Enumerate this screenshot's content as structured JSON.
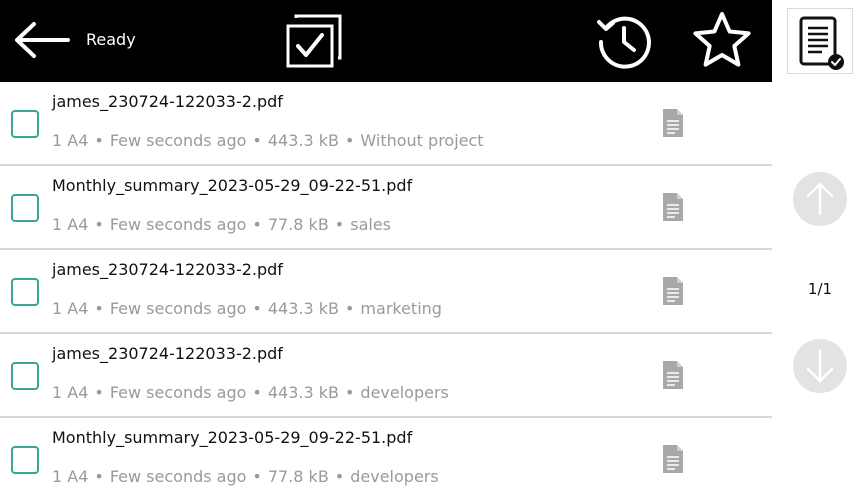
{
  "header": {
    "status": "Ready"
  },
  "pagination": {
    "indicator": "1/1"
  },
  "files": [
    {
      "name": "james_230724-122033-2.pdf",
      "pages": "1 A4",
      "time": "Few seconds ago",
      "size": "443.3 kB",
      "project": "Without project"
    },
    {
      "name": "Monthly_summary_2023-05-29_09-22-51.pdf",
      "pages": "1 A4",
      "time": "Few seconds ago",
      "size": "77.8 kB",
      "project": "sales"
    },
    {
      "name": "james_230724-122033-2.pdf",
      "pages": "1 A4",
      "time": "Few seconds ago",
      "size": "443.3 kB",
      "project": "marketing"
    },
    {
      "name": "james_230724-122033-2.pdf",
      "pages": "1 A4",
      "time": "Few seconds ago",
      "size": "443.3 kB",
      "project": "developers"
    },
    {
      "name": "Monthly_summary_2023-05-29_09-22-51.pdf",
      "pages": "1 A4",
      "time": "Few seconds ago",
      "size": "77.8 kB",
      "project": "developers"
    }
  ],
  "meta_separator": "•",
  "colors": {
    "header_bg": "#000000",
    "checkbox": "#3aa795",
    "meta_text": "#9a9a9a",
    "divider": "#d4d9dc",
    "scroll_button": "#e3e3e3"
  },
  "icons": {
    "back": "arrow-left-icon",
    "select_all": "select-all-icon",
    "history": "history-icon",
    "favorites": "star-icon",
    "documents": "document-check-icon",
    "file": "file-icon",
    "scroll_up": "arrow-up-icon",
    "scroll_down": "arrow-down-icon"
  }
}
